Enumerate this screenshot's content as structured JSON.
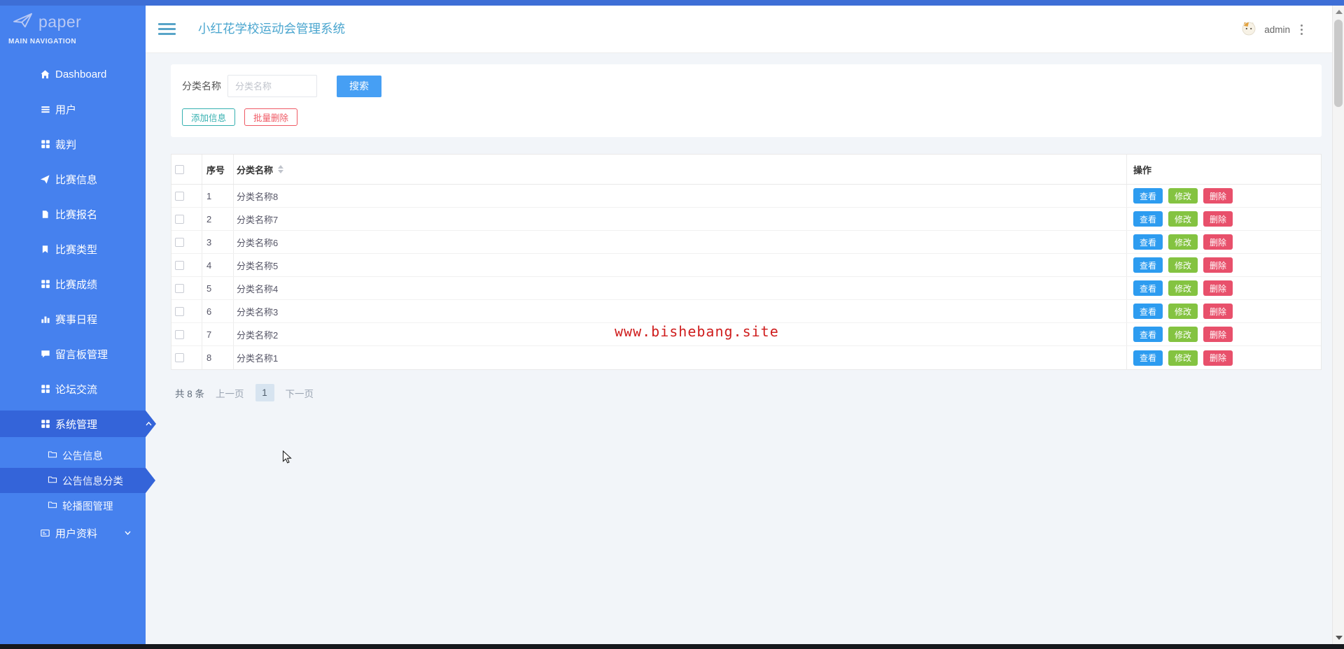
{
  "header": {
    "title": "小红花学校运动会管理系统",
    "username": "admin"
  },
  "sidebar": {
    "logo_text": "paper",
    "section_label": "MAIN NAVIGATION",
    "items": [
      {
        "label": "Dashboard",
        "icon": "home-icon"
      },
      {
        "label": "用户",
        "icon": "list-icon"
      },
      {
        "label": "裁判",
        "icon": "grid-icon"
      },
      {
        "label": "比赛信息",
        "icon": "send-icon"
      },
      {
        "label": "比赛报名",
        "icon": "file-icon"
      },
      {
        "label": "比赛类型",
        "icon": "book-icon"
      },
      {
        "label": "比赛成绩",
        "icon": "grid-icon"
      },
      {
        "label": "赛事日程",
        "icon": "chart-icon"
      },
      {
        "label": "留言板管理",
        "icon": "comment-icon"
      },
      {
        "label": "论坛交流",
        "icon": "grid-icon"
      },
      {
        "label": "系统管理",
        "icon": "grid-icon",
        "state": "active-expanded"
      },
      {
        "label": "用户资料",
        "icon": "idcard-icon",
        "state": "collapsed"
      }
    ],
    "submenu": [
      {
        "label": "公告信息",
        "icon": "folder-icon"
      },
      {
        "label": "公告信息分类",
        "icon": "folder-icon",
        "state": "active"
      },
      {
        "label": "轮播图管理",
        "icon": "folder-icon"
      }
    ]
  },
  "search": {
    "label": "分类名称",
    "placeholder": "分类名称",
    "button": "搜索"
  },
  "toolbar": {
    "add": "添加信息",
    "batch_delete": "批量删除"
  },
  "table": {
    "headers": {
      "index": "序号",
      "name": "分类名称",
      "actions": "操作"
    },
    "rows": [
      {
        "no": "1",
        "name": "分类名称8"
      },
      {
        "no": "2",
        "name": "分类名称7"
      },
      {
        "no": "3",
        "name": "分类名称6"
      },
      {
        "no": "4",
        "name": "分类名称5"
      },
      {
        "no": "5",
        "name": "分类名称4"
      },
      {
        "no": "6",
        "name": "分类名称3"
      },
      {
        "no": "7",
        "name": "分类名称2"
      },
      {
        "no": "8",
        "name": "分类名称1"
      }
    ],
    "row_actions": {
      "view": "查看",
      "edit": "修改",
      "delete": "删除"
    }
  },
  "pagination": {
    "total": "共 8 条",
    "prev": "上一页",
    "current": "1",
    "next": "下一页"
  },
  "watermark": "www.bishebang.site",
  "colors": {
    "sidebar_blue": "#4681ee",
    "sidebar_active_blue": "#3464d9",
    "header_title": "#4ba6cf",
    "search_button": "#469ff4",
    "add_button_teal": "#35b0b0",
    "batch_delete_red": "#ef5964",
    "action_view": "#2d9cf0",
    "action_edit": "#84c341",
    "action_delete": "#e8506b",
    "watermark_red": "#cf1d1d"
  }
}
